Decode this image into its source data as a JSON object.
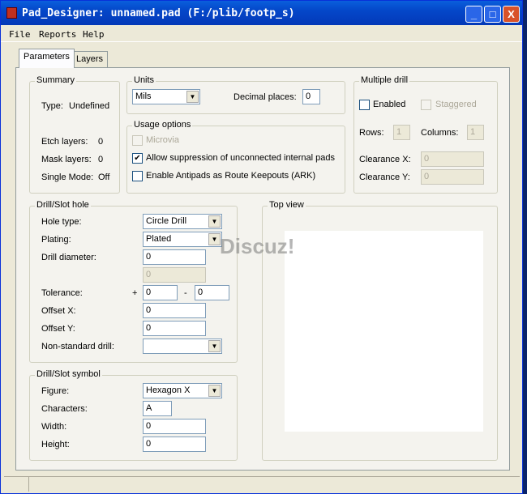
{
  "window": {
    "title": "Pad_Designer: unnamed.pad (F:/plib/footp_s)",
    "minimize": "_",
    "maximize": "□",
    "close": "X"
  },
  "menu": [
    "File",
    "Reports",
    "Help"
  ],
  "tabs": [
    "Parameters",
    "Layers"
  ],
  "summary": {
    "label": "Summary",
    "type_label": "Type:",
    "type_value": "Undefined",
    "etch_label": "Etch layers:",
    "etch_value": "0",
    "mask_label": "Mask layers:",
    "mask_value": "0",
    "single_label": "Single Mode:",
    "single_value": "Off"
  },
  "units": {
    "label": "Units",
    "value": "Mils",
    "decimal_label": "Decimal places:",
    "decimal_value": "0"
  },
  "usage": {
    "label": "Usage options",
    "microvia": "Microvia",
    "allow": "Allow suppression of unconnected internal pads",
    "antipads": "Enable Antipads as Route Keepouts (ARK)",
    "allow_checked": true
  },
  "multi": {
    "label": "Multiple drill",
    "enabled": "Enabled",
    "staggered": "Staggered",
    "rows_label": "Rows:",
    "rows": "1",
    "cols_label": "Columns:",
    "cols": "1",
    "clx_label": "Clearance X:",
    "clx": "0",
    "cly_label": "Clearance Y:",
    "cly": "0"
  },
  "drill": {
    "label": "Drill/Slot hole",
    "hole_type_label": "Hole type:",
    "hole_type": "Circle Drill",
    "plating_label": "Plating:",
    "plating": "Plated",
    "diameter_label": "Drill diameter:",
    "diameter": "0",
    "diameter2": "0",
    "tol_label": "Tolerance:",
    "plus": "+",
    "tol_plus": "0",
    "minus": "-",
    "tol_minus": "0",
    "offx_label": "Offset X:",
    "offx": "0",
    "offy_label": "Offset Y:",
    "offy": "0",
    "nonstd_label": "Non-standard drill:",
    "nonstd": ""
  },
  "symbol": {
    "label": "Drill/Slot symbol",
    "figure_label": "Figure:",
    "figure": "Hexagon X",
    "chars_label": "Characters:",
    "chars": "A",
    "width_label": "Width:",
    "width": "0",
    "height_label": "Height:",
    "height": "0"
  },
  "topview": {
    "label": "Top view"
  },
  "watermark": "Discuz!"
}
